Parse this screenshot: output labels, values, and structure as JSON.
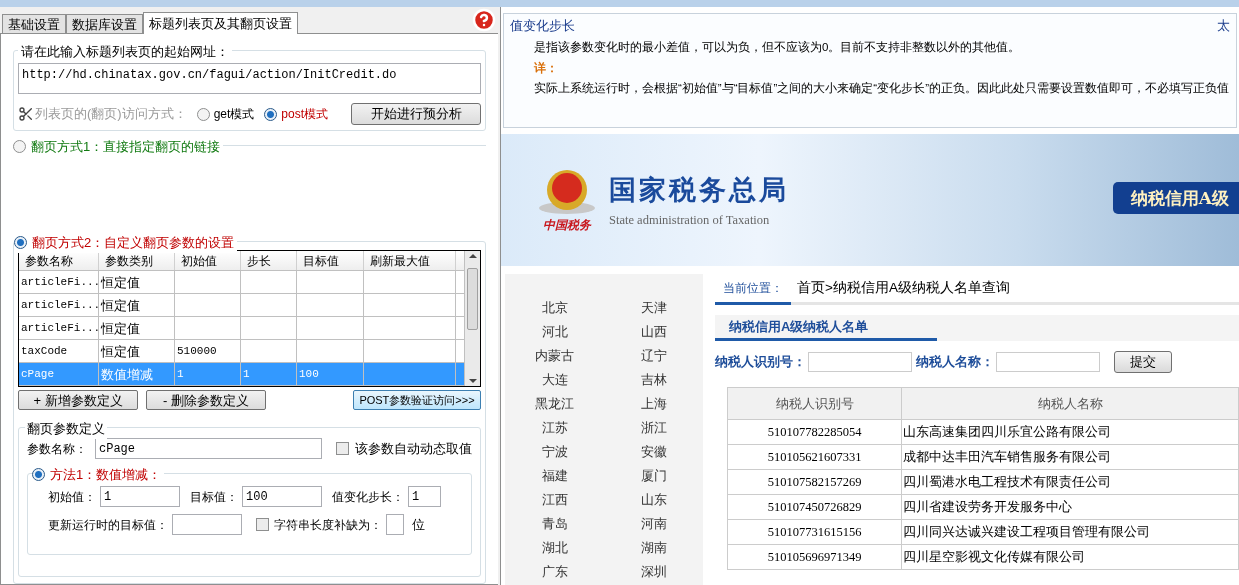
{
  "tabs": [
    {
      "label": "基础设置",
      "selected": false
    },
    {
      "label": "数据库设置",
      "selected": false
    },
    {
      "label": "标题列表页及其翻页设置",
      "selected": true
    }
  ],
  "url_group": {
    "legend": "请在此输入标题列表页的起始网址：",
    "url": "http://hd.chinatax.gov.cn/fagui/action/InitCredit.do",
    "mode_label": "列表页的(翻页)访问方式：",
    "modes": [
      {
        "label": "get模式",
        "selected": false
      },
      {
        "label": "post模式",
        "selected": true
      }
    ],
    "analyze_button": "开始进行预分析"
  },
  "paging1": {
    "label": "翻页方式1：直接指定翻页的链接",
    "selected": false
  },
  "paging2": {
    "label": "翻页方式2：自定义翻页参数的设置",
    "selected": true,
    "columns": [
      "参数名称",
      "参数类别",
      "初始值",
      "步长",
      "目标值",
      "刷新最大值"
    ],
    "rows": [
      {
        "cells": [
          "articleFi...",
          "恒定值",
          "",
          "",
          "",
          ""
        ],
        "selected": false
      },
      {
        "cells": [
          "articleFi...",
          "恒定值",
          "",
          "",
          "",
          ""
        ],
        "selected": false
      },
      {
        "cells": [
          "articleFi...",
          "恒定值",
          "",
          "",
          "",
          ""
        ],
        "selected": false
      },
      {
        "cells": [
          "taxCode",
          "恒定值",
          "510000",
          "",
          "",
          ""
        ],
        "selected": false
      },
      {
        "cells": [
          "cPage",
          "数值增减",
          "1",
          "1",
          "100",
          ""
        ],
        "selected": true
      }
    ],
    "add_button": "+ 新增参数定义",
    "remove_button": "- 删除参数定义",
    "post_button": "POST参数验证访问>>>"
  },
  "param_def": {
    "legend": "翻页参数定义",
    "name_label": "参数名称：",
    "name_value": "cPage",
    "auto_label": "该参数自动动态取值",
    "auto_checked": false,
    "method1": {
      "label": "方法1：数值增减：",
      "selected": true,
      "initial_label": "初始值：",
      "initial_value": "1",
      "target_label": "目标值：",
      "target_value": "100",
      "step_label": "值变化步长：",
      "step_value": "1",
      "runtime_label": "更新运行时的目标值：",
      "pad_label": "字符串长度补缺为：",
      "pad_checked": false,
      "pad_unit": "位"
    }
  },
  "help": {
    "title": "值变化步长",
    "side_text": "太",
    "paragraphs": [
      {
        "kind": "text",
        "text": "是指该参数变化时的最小差值，可以为负，但不应该为0。目前不支持非整数以外的其他值。"
      },
      {
        "kind": "heading",
        "text": "详："
      },
      {
        "kind": "text",
        "text": "实际上系统运行时，会根据“初始值”与“目标值”之间的大小来确定“变化步长”的正负。因此此处只需要设置数值即可，不必填写正负值"
      }
    ]
  },
  "web": {
    "emblem_caption": "中国税务",
    "title": "国家税务总局",
    "subtitle": "State administration of Taxation",
    "badge": "纳税信用A级",
    "provinces": [
      "北京",
      "天津",
      "河北",
      "山西",
      "内蒙古",
      "辽宁",
      "大连",
      "吉林",
      "黑龙江",
      "上海",
      "江苏",
      "浙江",
      "宁波",
      "安徽",
      "福建",
      "厦门",
      "江西",
      "山东",
      "青岛",
      "河南",
      "湖北",
      "湖南",
      "广东",
      "深圳"
    ],
    "location_label": "当前位置：",
    "breadcrumb": "首页>纳税信用A级纳税人名单查询",
    "section_title": "纳税信用A级纳税人名单",
    "id_label": "纳税人识别号：",
    "name_label": "纳税人名称：",
    "submit": "提交",
    "columns": [
      "纳税人识别号",
      "纳税人名称"
    ],
    "rows": [
      [
        "510107782285054",
        "山东高速集团四川乐宜公路有限公司"
      ],
      [
        "510105621607331",
        "成都中达丰田汽车销售服务有限公司"
      ],
      [
        "510107582157269",
        "四川蜀港水电工程技术有限责任公司"
      ],
      [
        "510107450726829",
        "四川省建设劳务开发服务中心"
      ],
      [
        "510107731615156",
        "四川同兴达诚兴建设工程项目管理有限公司"
      ],
      [
        "510105696971349",
        "四川星空影视文化传媒有限公司"
      ]
    ]
  }
}
